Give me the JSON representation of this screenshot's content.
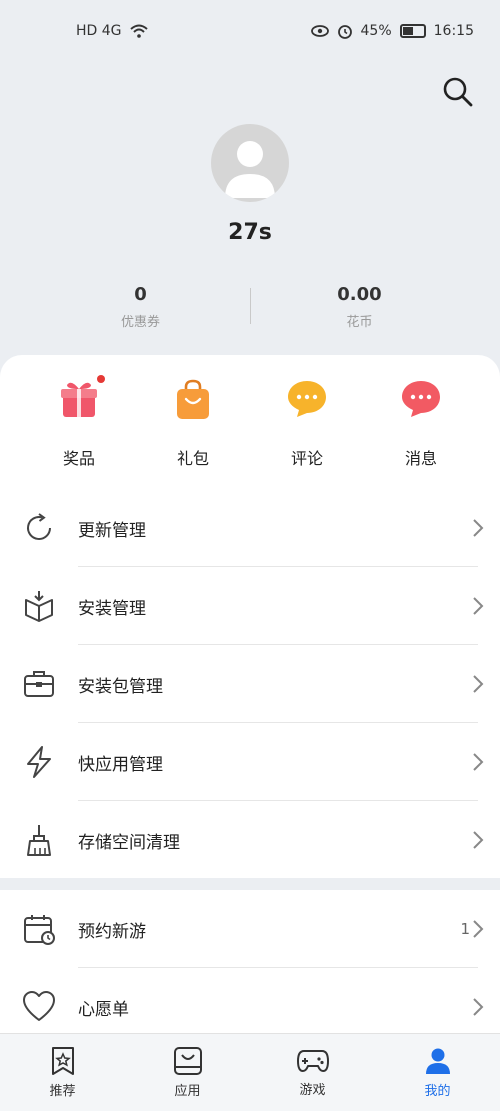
{
  "status_bar": {
    "left": "HD 4G",
    "battery": "45%",
    "time": "16:15"
  },
  "profile": {
    "username": "27s"
  },
  "stats": [
    {
      "value": "0",
      "label": "优惠券"
    },
    {
      "value": "0.00",
      "label": "花币"
    }
  ],
  "quick_actions": [
    {
      "label": "奖品",
      "icon": "gift-icon"
    },
    {
      "label": "礼包",
      "icon": "bag-icon"
    },
    {
      "label": "评论",
      "icon": "comment-icon"
    },
    {
      "label": "消息",
      "icon": "message-icon"
    }
  ],
  "menu": [
    {
      "label": "更新管理",
      "icon": "refresh-icon"
    },
    {
      "label": "安装管理",
      "icon": "box-download-icon"
    },
    {
      "label": "安装包管理",
      "icon": "briefcase-icon"
    },
    {
      "label": "快应用管理",
      "icon": "lightning-icon"
    },
    {
      "label": "存储空间清理",
      "icon": "broom-icon"
    }
  ],
  "menu2": [
    {
      "label": "预约新游",
      "icon": "calendar-icon",
      "count": "1"
    },
    {
      "label": "心愿单",
      "icon": "heart-icon"
    }
  ],
  "bottom_nav": [
    {
      "label": "推荐",
      "icon": "bookmark-star-icon"
    },
    {
      "label": "应用",
      "icon": "app-store-icon"
    },
    {
      "label": "游戏",
      "icon": "gamepad-icon"
    },
    {
      "label": "我的",
      "icon": "person-icon"
    }
  ],
  "colors": {
    "accent": "#1e6fe8",
    "gift": "#f0566a",
    "bag": "#f79c3a",
    "comment": "#f7b32b",
    "message": "#f25a63"
  }
}
